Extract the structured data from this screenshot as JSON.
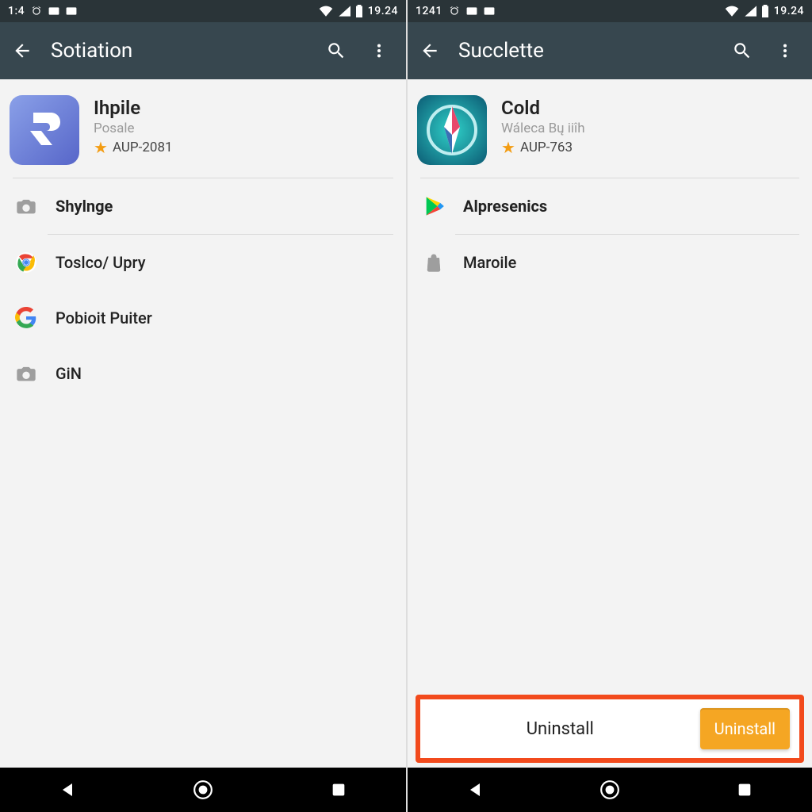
{
  "left": {
    "statusbar": {
      "time_left": "1:4",
      "time_right": "19.24"
    },
    "appbar": {
      "title": "Sotiation"
    },
    "app": {
      "name": "Ihpile",
      "subtitle": "Posale",
      "code": "AUP-2081"
    },
    "rows": [
      {
        "label": "Shylnge"
      },
      {
        "label": "Toslco/ Upry"
      },
      {
        "label": "Pobioit Puiter"
      },
      {
        "label": "GiN"
      }
    ]
  },
  "right": {
    "statusbar": {
      "time_left": "1241",
      "time_right": "19.24"
    },
    "appbar": {
      "title": "Succlette"
    },
    "app": {
      "name": "Cold",
      "subtitle": "Wáleca Bų iiîh",
      "code": "AUP-763"
    },
    "rows": [
      {
        "label": "Alpresenics"
      },
      {
        "label": "Maroile"
      }
    ],
    "uninstall": {
      "text": "Uninstall",
      "button": "Uninstall"
    }
  }
}
